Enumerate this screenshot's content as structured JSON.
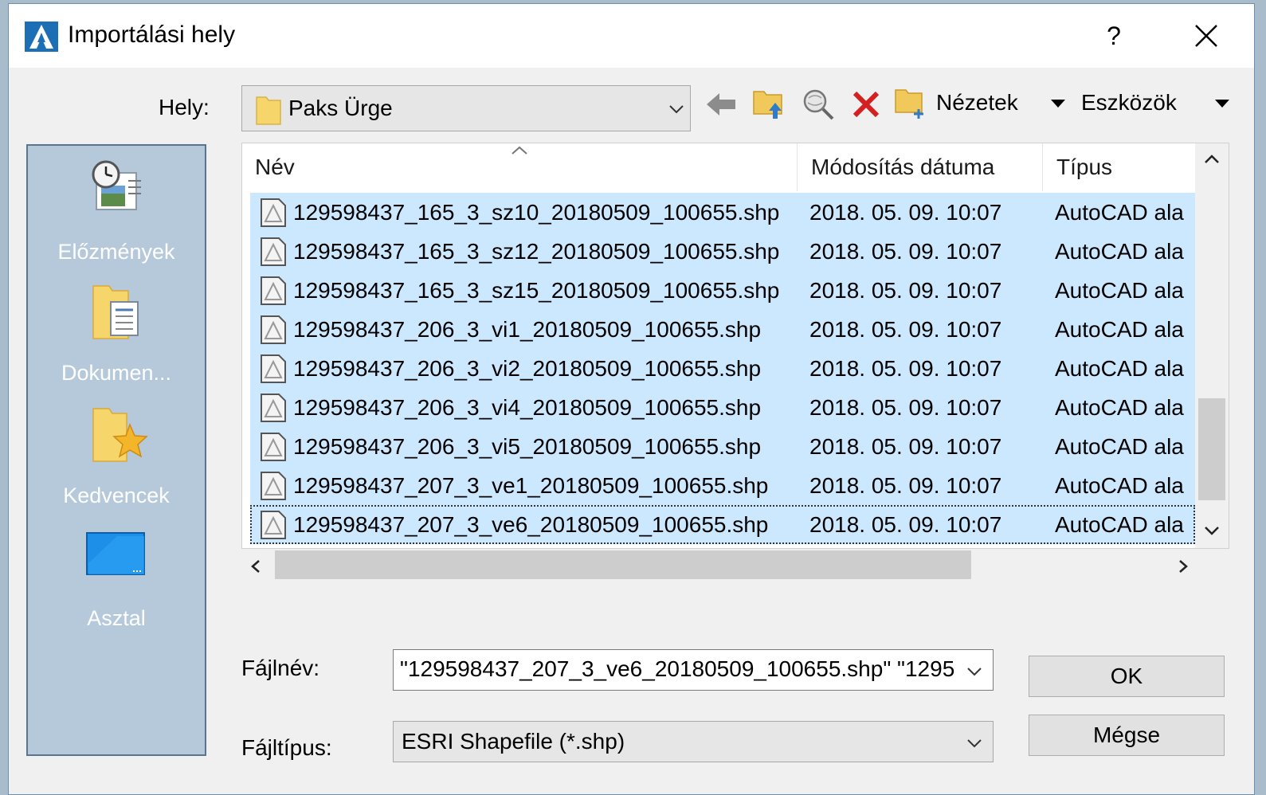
{
  "window": {
    "title": "Importálási hely",
    "help_label": "?"
  },
  "location": {
    "label": "Hely:",
    "value": "Paks Ürge"
  },
  "toolbar": {
    "views_label": "Nézetek",
    "tools_label": "Eszközök"
  },
  "places": [
    {
      "label": "Előzmények",
      "icon": "history-icon"
    },
    {
      "label": "Dokumen...",
      "icon": "documents-icon"
    },
    {
      "label": "Kedvencek",
      "icon": "favorites-icon"
    },
    {
      "label": "Asztal",
      "icon": "desktop-icon"
    }
  ],
  "columns": {
    "name": "Név",
    "modified": "Módosítás dátuma",
    "type": "Típus"
  },
  "files": [
    {
      "name": "129598437_165_3_sz10_20180509_100655.shp",
      "modified": "2018. 05. 09. 10:07",
      "type": "AutoCAD ala"
    },
    {
      "name": "129598437_165_3_sz12_20180509_100655.shp",
      "modified": "2018. 05. 09. 10:07",
      "type": "AutoCAD ala"
    },
    {
      "name": "129598437_165_3_sz15_20180509_100655.shp",
      "modified": "2018. 05. 09. 10:07",
      "type": "AutoCAD ala"
    },
    {
      "name": "129598437_206_3_vi1_20180509_100655.shp",
      "modified": "2018. 05. 09. 10:07",
      "type": "AutoCAD ala"
    },
    {
      "name": "129598437_206_3_vi2_20180509_100655.shp",
      "modified": "2018. 05. 09. 10:07",
      "type": "AutoCAD ala"
    },
    {
      "name": "129598437_206_3_vi4_20180509_100655.shp",
      "modified": "2018. 05. 09. 10:07",
      "type": "AutoCAD ala"
    },
    {
      "name": "129598437_206_3_vi5_20180509_100655.shp",
      "modified": "2018. 05. 09. 10:07",
      "type": "AutoCAD ala"
    },
    {
      "name": "129598437_207_3_ve1_20180509_100655.shp",
      "modified": "2018. 05. 09. 10:07",
      "type": "AutoCAD ala"
    },
    {
      "name": "129598437_207_3_ve6_20180509_100655.shp",
      "modified": "2018. 05. 09. 10:07",
      "type": "AutoCAD ala"
    }
  ],
  "filename": {
    "label": "Fájlnév:",
    "value": "\"129598437_207_3_ve6_20180509_100655.shp\" \"1295"
  },
  "filetype": {
    "label": "Fájltípus:",
    "value": "ESRI Shapefile  (*.shp)"
  },
  "buttons": {
    "ok": "OK",
    "cancel": "Mégse"
  },
  "colors": {
    "selection": "#cce8ff",
    "places_bg": "#b6c9db",
    "accent": "#1e72c8"
  }
}
